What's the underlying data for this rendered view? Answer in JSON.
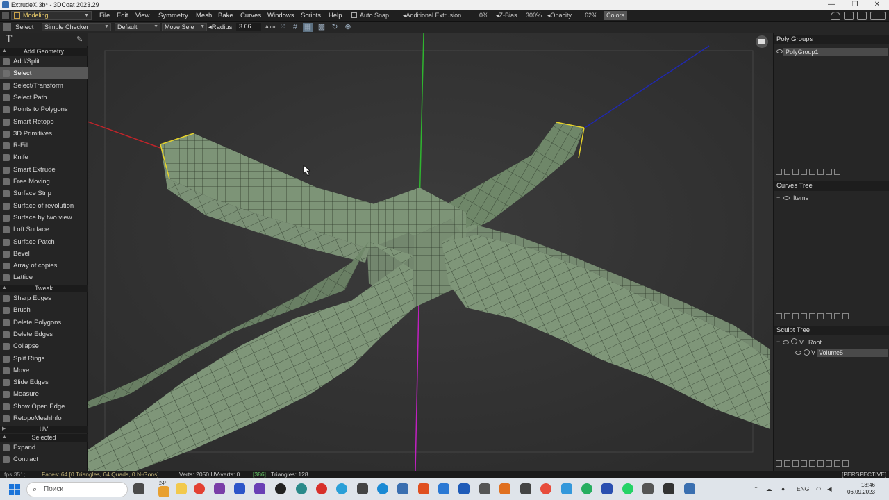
{
  "window": {
    "title": "ExtrudeX.3b* - 3DCoat 2023.29",
    "controls": [
      "—",
      "❐",
      "✕"
    ]
  },
  "menubar": {
    "mode": "Modeling",
    "items": [
      "File",
      "Edit",
      "View",
      "Symmetry",
      "Mesh",
      "Bake",
      "Curves",
      "Windows",
      "Scripts",
      "Help"
    ],
    "auto_snap": "Auto Snap",
    "additional_extrusion": "Additional Extrusion",
    "additional_extrusion_value": "0%",
    "zbias": "Z-Bias",
    "zbias_value": "300%",
    "opacity": "Opacity",
    "opacity_value": "62%",
    "colors": "Colors"
  },
  "toolbar": {
    "tool": "Select",
    "checker": "Simple Checker",
    "default": "Default",
    "move": "Move Sele",
    "radius_label": "Radius",
    "radius_value": "3.66",
    "auto": "Auto"
  },
  "left_panel": {
    "add_geometry_header": "Add Geometry",
    "add_geometry": [
      "Add/Split",
      "Select",
      "Select/Transform",
      "Select Path",
      "Points to Polygons",
      "Smart Retopo",
      "3D Primitives",
      "R-Fill",
      "Knife",
      "Smart Extrude",
      "Free Moving",
      "Surface Strip",
      "Surface of revolution",
      "Surface by two view",
      "Loft Surface",
      "Surface Patch",
      "Bevel",
      "Array of copies",
      "Lattice"
    ],
    "tweak_header": "Tweak",
    "tweak": [
      "Sharp Edges",
      "Brush",
      "Delete Polygons",
      "Delete Edges",
      "Collapse",
      "Split Rings",
      "Move",
      "Slide Edges",
      "Measure",
      "Show Open Edge",
      "RetopoMeshInfo"
    ],
    "uv_header": "UV",
    "selected_header": "Selected",
    "selected": [
      "Expand",
      "Contract"
    ]
  },
  "right_panel": {
    "poly_groups_title": "Poly Groups",
    "poly_group": "PolyGroup1",
    "curves_tree_title": "Curves Tree",
    "curves_item": "Items",
    "sculpt_tree_title": "Sculpt Tree",
    "sculpt_root": "Root",
    "sculpt_volume": "Volume5",
    "v_label": "V"
  },
  "status": {
    "fps": "fps:351;",
    "faces": "Faces: 64 [0 Triangles, 64 Quads, 0 N-Gons]",
    "verts": "Verts: 2050 UV-verts: 0",
    "uv_count": "[386]",
    "triangles": "Triangles: 128",
    "view_mode": "[PERSPECTIVE]"
  },
  "taskbar": {
    "search": "Поиск",
    "weather": "24°",
    "lang": "ENG",
    "time": "18:46",
    "date": "06.09.2023"
  },
  "colors": {
    "mesh": "#7d9477",
    "mesh_dark": "#5f7559",
    "grid": "#2e3a2b",
    "axis_x": "#c0242a",
    "axis_y": "#2fb52f",
    "axis_z": "#1f28b0",
    "axis_y_neg": "#c020c0",
    "highlight": "#e6d22a"
  }
}
